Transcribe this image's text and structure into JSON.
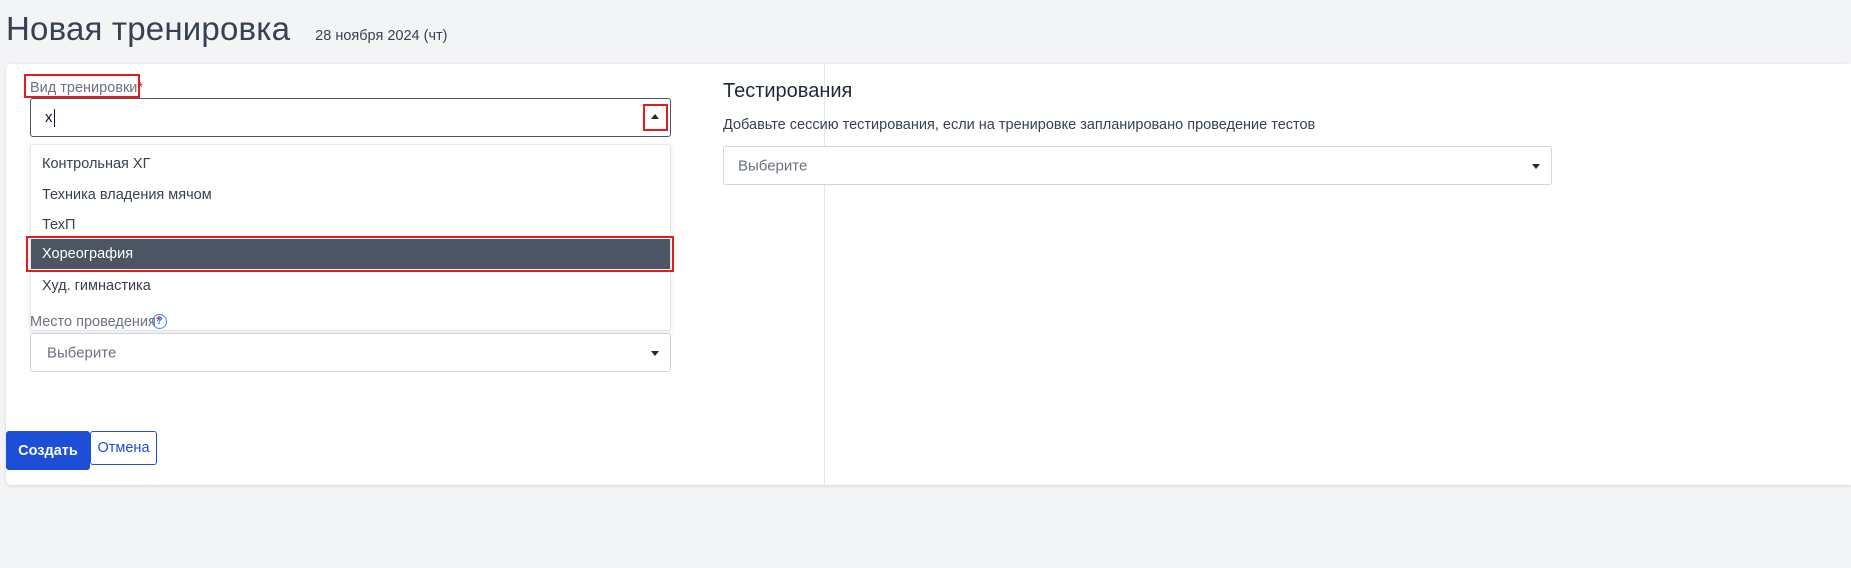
{
  "header": {
    "title": "Новая тренировка",
    "date": "28 ноября 2024 (чт)"
  },
  "form": {
    "training_type": {
      "label": "Вид тренировки",
      "required_mark": "*",
      "input_value": "х",
      "options": [
        "Контрольная ХГ",
        "Техника владения мячом",
        "ТехП",
        "Хореография",
        "Худ. гимнастика"
      ],
      "selected_index": 3
    },
    "location": {
      "label": "Место проведения",
      "required_mark": "*",
      "help_glyph": "?",
      "placeholder": "Выберите"
    }
  },
  "testing": {
    "title": "Тестирования",
    "description": "Добавьте сессию тестирования, если на тренировке запланировано проведение тестов",
    "placeholder": "Выберите"
  },
  "actions": {
    "create_label": "Создать",
    "cancel_label": "Отмена"
  },
  "colors": {
    "primary": "#1d4ed8",
    "selected_option_bg": "#4b5563",
    "highlight_border": "#e11d1d",
    "required": "#dc2626",
    "page_bg": "#f3f4f6"
  },
  "icons": {
    "dropdown_open": "caret-up-icon",
    "dropdown_closed": "caret-down-icon",
    "help": "question-circle-icon"
  }
}
